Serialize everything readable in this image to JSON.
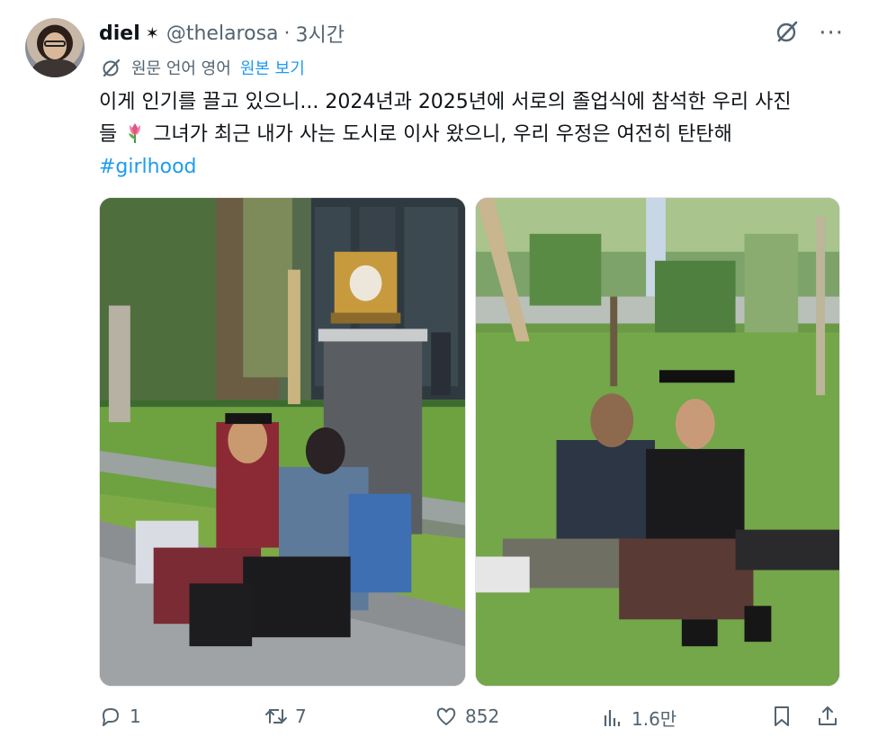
{
  "author": {
    "display_name": "diel",
    "badge": "✶",
    "handle": "@thelarosa",
    "separator": "·",
    "time": "3시간"
  },
  "header_icons": {
    "grok": "grok-icon",
    "more": "···"
  },
  "translation": {
    "label": "원문 언어 영어",
    "show_original": "원본 보기"
  },
  "tweet": {
    "line1": "이게 인기를 끌고 있으니... 2024년과 2025년에 서로의 졸업식에 참석한 우리 사진",
    "line2_before": "들",
    "line2_after": "그녀가 최근 내가 사는 도시로 이사 왔으니, 우리 우정은 여전히 탄탄해",
    "hashtag": "#girlhood"
  },
  "metrics": {
    "replies": "1",
    "retweets": "7",
    "likes": "852",
    "views": "1.6만"
  },
  "colors": {
    "text": "#0f1419",
    "secondary": "#536471",
    "link": "#1d9bf0"
  }
}
